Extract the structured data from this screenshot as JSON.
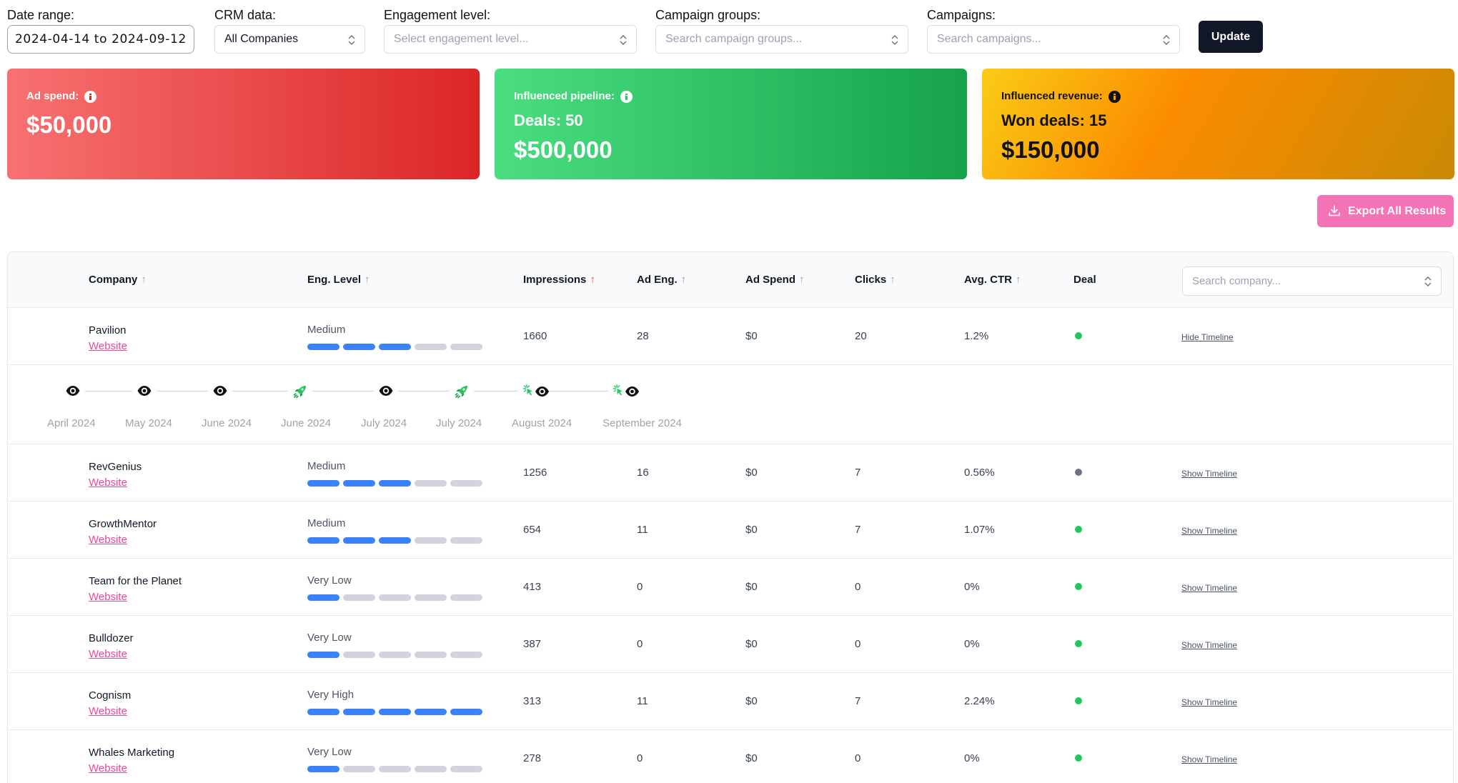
{
  "filters": {
    "date_range_label": "Date range:",
    "date_range_value": "2024-04-14  to  2024-09-12",
    "crm_label": "CRM data:",
    "crm_value": "All Companies",
    "engagement_label": "Engagement level:",
    "engagement_placeholder": "Select engagement level...",
    "campaign_groups_label": "Campaign groups:",
    "campaign_groups_placeholder": "Search campaign groups...",
    "campaigns_label": "Campaigns:",
    "campaigns_placeholder": "Search campaigns...",
    "update_label": "Update"
  },
  "cards": {
    "ad_spend_label": "Ad spend:",
    "ad_spend_value": "$50,000",
    "pipeline_label": "Influenced pipeline:",
    "pipeline_deals": "Deals: 50",
    "pipeline_value": "$500,000",
    "revenue_label": "Influenced revenue:",
    "revenue_deals": "Won deals: 15",
    "revenue_value": "$150,000"
  },
  "export_label": "Export All Results",
  "table": {
    "headers": {
      "company": "Company",
      "eng_level": "Eng. Level",
      "impressions": "Impressions",
      "ad_eng": "Ad Eng.",
      "ad_spend": "Ad Spend",
      "clicks": "Clicks",
      "avg_ctr": "Avg. CTR",
      "deal": "Deal"
    },
    "search_placeholder": "Search company...",
    "rows": [
      {
        "company": "Pavilion",
        "website": "Website",
        "eng_level": "Medium",
        "eng_bars": 3,
        "impressions": "1660",
        "ad_eng": "28",
        "ad_spend": "$0",
        "clicks": "20",
        "avg_ctr": "1.2%",
        "deal": "green",
        "timeline_link": "Hide Timeline"
      },
      {
        "company": "RevGenius",
        "website": "Website",
        "eng_level": "Medium",
        "eng_bars": 3,
        "impressions": "1256",
        "ad_eng": "16",
        "ad_spend": "$0",
        "clicks": "7",
        "avg_ctr": "0.56%",
        "deal": "gray",
        "timeline_link": "Show Timeline"
      },
      {
        "company": "GrowthMentor",
        "website": "Website",
        "eng_level": "Medium",
        "eng_bars": 3,
        "impressions": "654",
        "ad_eng": "11",
        "ad_spend": "$0",
        "clicks": "7",
        "avg_ctr": "1.07%",
        "deal": "green",
        "timeline_link": "Show Timeline"
      },
      {
        "company": "Team for the Planet",
        "website": "Website",
        "eng_level": "Very Low",
        "eng_bars": 1,
        "impressions": "413",
        "ad_eng": "0",
        "ad_spend": "$0",
        "clicks": "0",
        "avg_ctr": "0%",
        "deal": "green",
        "timeline_link": "Show Timeline"
      },
      {
        "company": "Bulldozer",
        "website": "Website",
        "eng_level": "Very Low",
        "eng_bars": 1,
        "impressions": "387",
        "ad_eng": "0",
        "ad_spend": "$0",
        "clicks": "0",
        "avg_ctr": "0%",
        "deal": "green",
        "timeline_link": "Show Timeline"
      },
      {
        "company": "Cognism",
        "website": "Website",
        "eng_level": "Very High",
        "eng_bars": 5,
        "impressions": "313",
        "ad_eng": "11",
        "ad_spend": "$0",
        "clicks": "7",
        "avg_ctr": "2.24%",
        "deal": "green",
        "timeline_link": "Show Timeline"
      },
      {
        "company": "Whales Marketing",
        "website": "Website",
        "eng_level": "Very Low",
        "eng_bars": 1,
        "impressions": "278",
        "ad_eng": "0",
        "ad_spend": "$0",
        "clicks": "0",
        "avg_ctr": "0%",
        "deal": "green",
        "timeline_link": "Show Timeline"
      }
    ]
  },
  "timeline": {
    "events": [
      {
        "label": "April 2024",
        "icon": "eye-icon"
      },
      {
        "label": "May 2024",
        "icon": "eye-icon"
      },
      {
        "label": "June 2024",
        "icon": "eye-icon"
      },
      {
        "label": "June 2024",
        "icon": "rocket-icon"
      },
      {
        "label": "July 2024",
        "icon": "eye-icon"
      },
      {
        "label": "July 2024",
        "icon": "rocket-icon"
      },
      {
        "label": "August 2024",
        "icon": "click-eye-icon"
      },
      {
        "label": "September 2024",
        "icon": "click-eye-icon"
      }
    ]
  },
  "colors": {
    "ad_spend_card": "#ef4444",
    "pipeline_card": "#22c55e",
    "revenue_card": "#f59e0b",
    "eng_bar_active": "#3b82f6",
    "link": "#ec4899",
    "deal_won": "#22c55e",
    "deal_none": "#6b7280"
  }
}
